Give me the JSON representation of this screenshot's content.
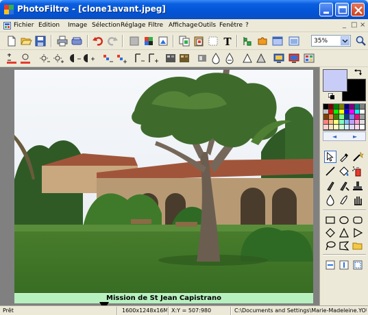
{
  "window": {
    "app_name": "PhotoFiltre",
    "separator": " - ",
    "document": "[clone1avant.jpeg]"
  },
  "menu": {
    "items": [
      "Fichier",
      "Edition",
      "Image",
      "Sélection",
      "Réglage",
      "Filtre",
      "Affichage",
      "Outils",
      "Fenêtre",
      "?"
    ],
    "controls": [
      "_",
      "□",
      "×"
    ]
  },
  "toolbar": {
    "zoom_value": "35%",
    "text_tool_glyph": "T"
  },
  "image": {
    "caption": "Mission de St Jean Capistrano"
  },
  "palette": {
    "foreground_color": "#c8cdf8",
    "background_color": "#000000",
    "swatches": [
      "#000000",
      "#800000",
      "#008000",
      "#808000",
      "#000080",
      "#800080",
      "#008080",
      "#808080",
      "#c0c0c0",
      "#ff0000",
      "#00ff00",
      "#ffff00",
      "#0000ff",
      "#ff00ff",
      "#00ffff",
      "#ffffff",
      "#7f3f00",
      "#ff8040",
      "#408000",
      "#80ff80",
      "#004080",
      "#8080ff",
      "#ff0080",
      "#a0a0a0",
      "#ff8080",
      "#ffc080",
      "#ffff80",
      "#80ffc0",
      "#80c0ff",
      "#c0a0ff",
      "#ffa0d0",
      "#e0e0e0",
      "#ffd0d0",
      "#ffe8c0",
      "#ffffc0",
      "#d0ffd0",
      "#d0f0ff",
      "#e0d8ff",
      "#ffd8ec",
      "#ffffff"
    ],
    "nav_left": "◄",
    "nav_right": "►"
  },
  "status": {
    "state": "Prêt",
    "dimensions": "1600x1248x16M",
    "coords": "X:Y = 507:980",
    "path": "C:\\Documents and Settings\\Marie-Madeleine.YOU"
  }
}
